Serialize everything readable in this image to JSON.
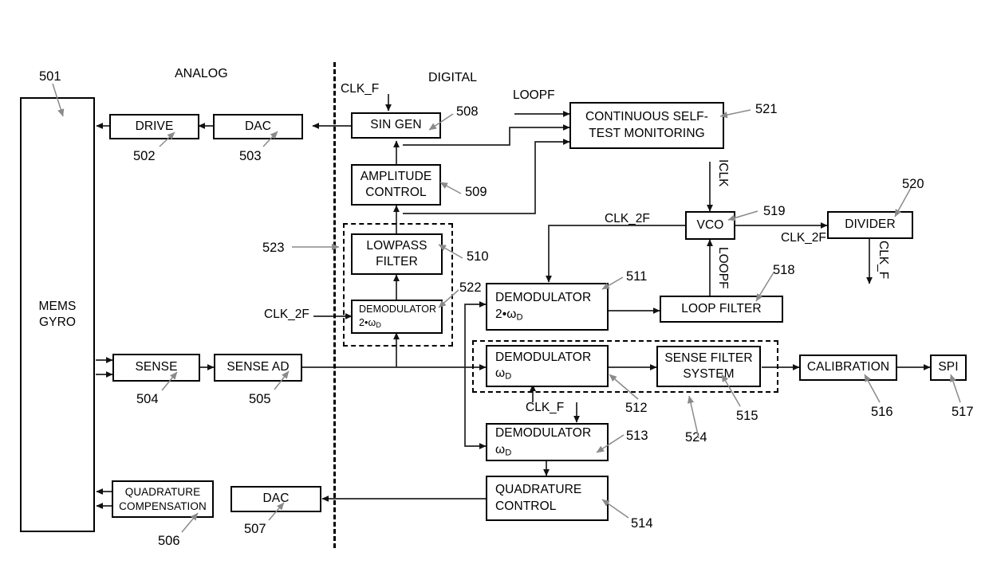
{
  "figure": {
    "sections": {
      "analog": "ANALOG",
      "digital": "DIGITAL"
    },
    "blocks": {
      "mems_gyro": {
        "line1": "MEMS",
        "line2": "GYRO",
        "ref": "501"
      },
      "drive": {
        "line1": "DRIVE",
        "ref": "502"
      },
      "dac_drive": {
        "line1": "DAC",
        "ref": "503"
      },
      "sense": {
        "line1": "SENSE",
        "ref": "504"
      },
      "sense_ad": {
        "line1": "SENSE AD",
        "ref": "505"
      },
      "quadrature_compensation": {
        "line1": "QUADRATURE",
        "line2": "COMPENSATION",
        "ref": "506"
      },
      "dac_quad": {
        "line1": "DAC",
        "ref": "507"
      },
      "sin_gen": {
        "line1": "SIN GEN",
        "ref": "508"
      },
      "amplitude_control": {
        "line1": "AMPLITUDE",
        "line2": "CONTROL",
        "ref": "509"
      },
      "lowpass_filter": {
        "line1": "LOWPASS",
        "line2": "FILTER",
        "ref": "510"
      },
      "demodulator_2wd_inner": {
        "line1": "DEMODULATOR",
        "line2": "2•ω",
        "sub": "D",
        "ref": "522"
      },
      "demodulator_2wd": {
        "line1": "DEMODULATOR",
        "line2": "2•ω",
        "sub": "D",
        "ref": "511"
      },
      "demodulator_wd_sense": {
        "line1": "DEMODULATOR",
        "line2": "ω",
        "sub": "D",
        "ref": "512"
      },
      "demodulator_wd_quad": {
        "line1": "DEMODULATOR",
        "line2": "ω",
        "sub": "D",
        "ref": "513"
      },
      "quadrature_control": {
        "line1": "QUADRATURE",
        "line2": "CONTROL",
        "ref": "514"
      },
      "sense_filter_system": {
        "line1": "SENSE FILTER",
        "line2": "SYSTEM",
        "ref": "515"
      },
      "calibration": {
        "line1": "CALIBRATION",
        "ref": "516"
      },
      "spi": {
        "line1": "SPI",
        "ref": "517"
      },
      "loop_filter": {
        "line1": "LOOP FILTER",
        "ref": "518"
      },
      "vco": {
        "line1": "VCO",
        "ref": "519"
      },
      "divider": {
        "line1": "DIVIDER",
        "ref": "520"
      },
      "continuous_self_test": {
        "line1": "CONTINUOUS SELF-",
        "line2": "TEST MONITORING",
        "ref": "521"
      }
    },
    "groups": {
      "drive_loop_group": {
        "ref": "523"
      },
      "sense_path_group": {
        "ref": "524"
      }
    },
    "signals": {
      "clk_f_singen": "CLK_F",
      "clk_f_demod": "CLK_F",
      "clk_f_divider": "CLK_F",
      "clk_2f_demod_inner": "CLK_2F",
      "clk_2f_vco_in": "CLK_2F",
      "clk_2f_vco_out": "CLK_2F",
      "loopf_selftest": "LOOPF",
      "loopf_vco": "LOOPF",
      "iclk": "ICLK"
    },
    "colors": {
      "line": "#000000",
      "leader": "#808080",
      "background": "#ffffff"
    }
  }
}
